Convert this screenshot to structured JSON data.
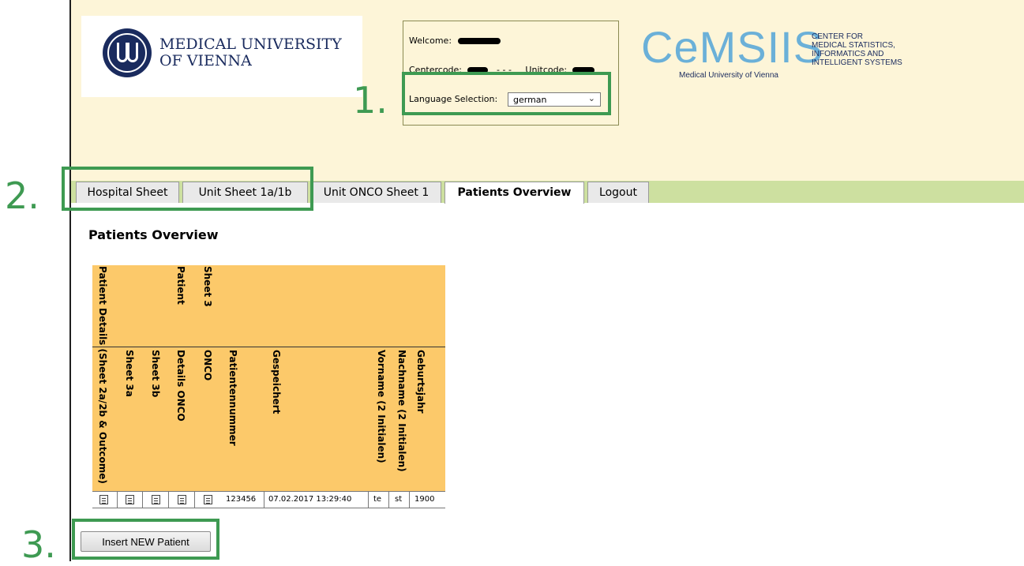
{
  "header": {
    "mu_logo_text": [
      "MEDICAL UNIVERSITY",
      "OF VIENNA"
    ],
    "welcome_label": "Welcome:",
    "centercode_label": "Centercode:",
    "centercode_sep": "- - -",
    "unitcode_label": "Unitcode:",
    "language_label": "Language Selection:",
    "language_value": "german",
    "cemsiis_logo": "CeMSIIS",
    "cemsiis_sub": "Medical University of Vienna",
    "cemsiis_right": [
      "CENTER FOR",
      "MEDICAL STATISTICS,",
      "INFORMATICS AND",
      "INTELLIGENT SYSTEMS"
    ]
  },
  "tabs": [
    {
      "label": "Hospital Sheet",
      "active": false
    },
    {
      "label": "Unit Sheet 1a/1b",
      "active": false
    },
    {
      "label": "Unit ONCO Sheet 1",
      "active": false
    },
    {
      "label": "Patients Overview",
      "active": true
    },
    {
      "label": "Logout",
      "active": false
    }
  ],
  "page_title": "Patients Overview",
  "table": {
    "top_headers": [
      "Patient Details (Sheet 2a/2b & Outcome)",
      "Patient",
      "Sheet 3"
    ],
    "sub_headers": [
      "Sheet 3a",
      "Sheet 3b",
      "Details ONCO",
      "ONCO",
      "Patientennummer",
      "Gespeichert",
      "Vorname (2 Initialen)",
      "Nachname (2 Initialen)",
      "Geburtsjahr"
    ],
    "rows": [
      {
        "patient_number": "123456",
        "saved": "07.02.2017 13:29:40",
        "first_name": "te",
        "last_name": "st",
        "birth_year": "1900"
      }
    ]
  },
  "insert_button": "Insert NEW Patient",
  "annotations": [
    "1.",
    "2.",
    "3."
  ],
  "colors": {
    "header_bg": "#fdf5d8",
    "nav_bar": "#cde0a0",
    "table_header": "#fcc96a",
    "annotation": "#3e9a52"
  }
}
